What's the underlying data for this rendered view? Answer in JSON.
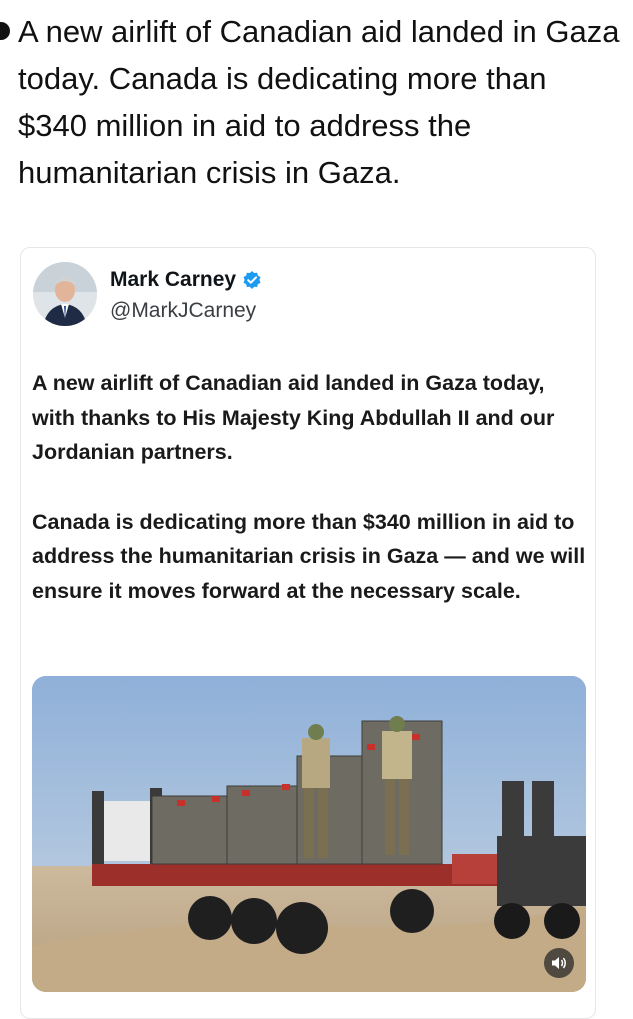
{
  "headline": "A new airlift of Canadian aid landed in Gaza today. Canada is dedicating more than $340 million in aid to address the humanitarian crisis in Gaza.",
  "post": {
    "author_name": "Mark Carney",
    "author_handle": "@MarkJCarney",
    "paragraphs": [
      "A new airlift of Canadian aid landed in Gaza today, with thanks to His Majesty King Abdullah II and our Jordanian partners.",
      "Canada is dedicating more than $340 million in aid to address the humanitarian crisis in Gaza — and we will ensure it moves forward at the necessary scale."
    ]
  },
  "icons": {
    "bullet": "bullet-dot-icon",
    "verified": "verified-badge-icon",
    "sound": "speaker-icon"
  },
  "colors": {
    "verified": "#1d9bf0",
    "text": "#0f1419",
    "handle": "#3a3f44"
  }
}
